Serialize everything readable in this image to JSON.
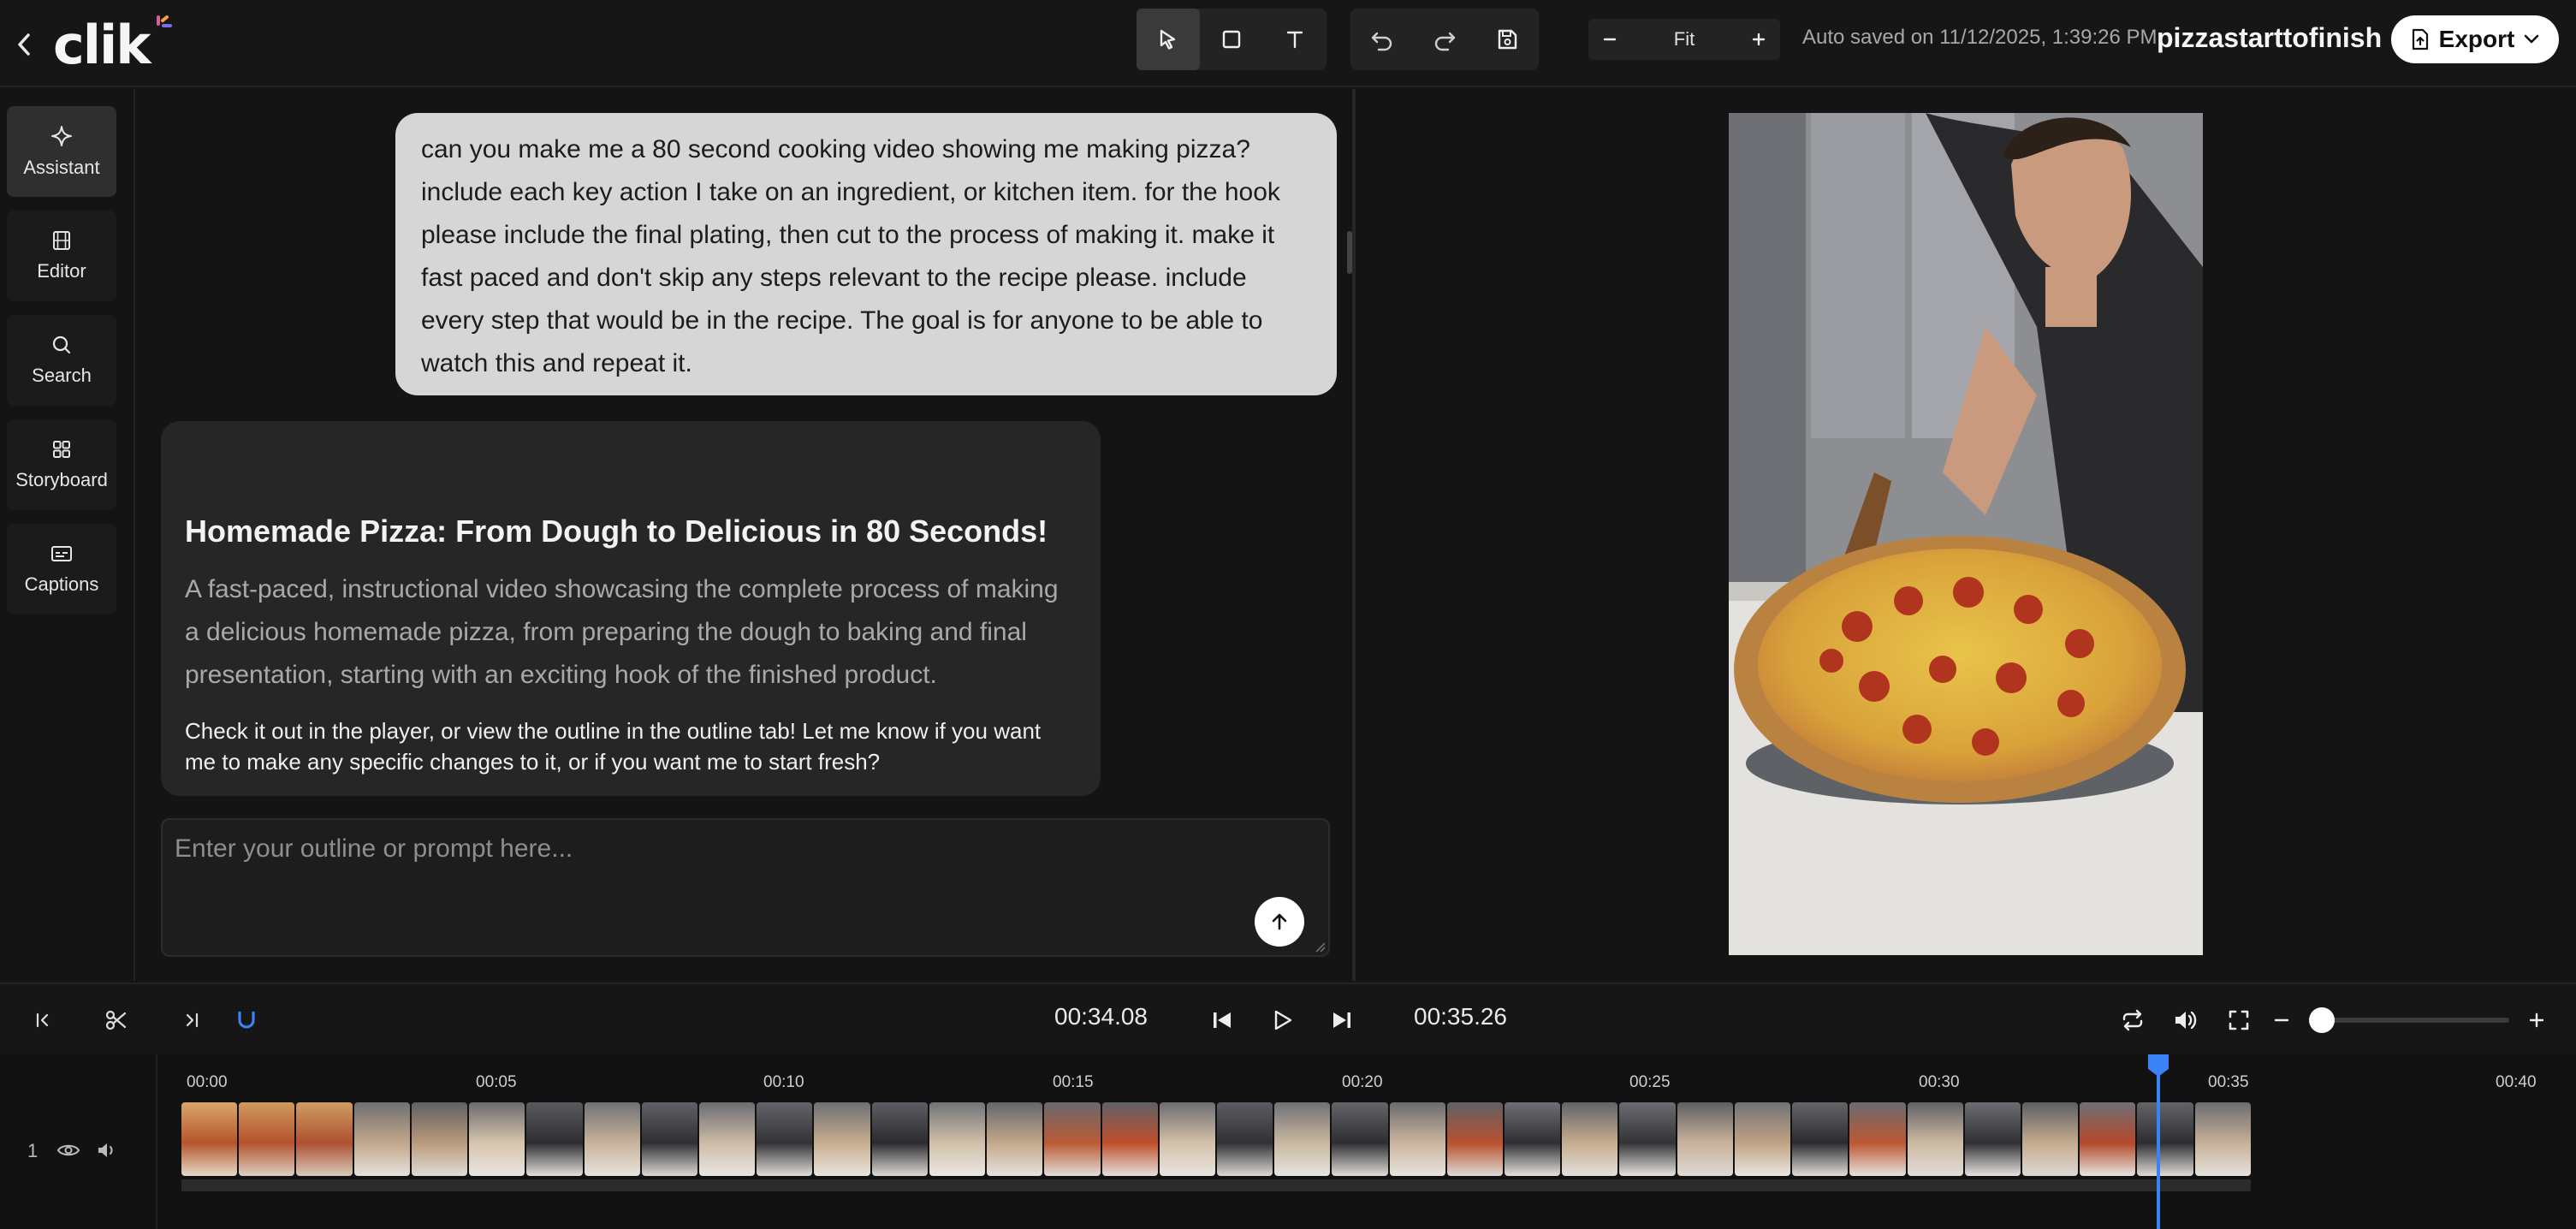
{
  "app": {
    "logo_text": "clik",
    "autosave_text": "Auto saved on 11/12/2025, 1:39:26 PM",
    "project_name": "pizzastarttofinish",
    "export_label": "Export",
    "zoom_label": "Fit"
  },
  "nav": {
    "items": [
      {
        "label": "Assistant",
        "icon": "sparkle-icon",
        "active": true
      },
      {
        "label": "Editor",
        "icon": "film-icon"
      },
      {
        "label": "Search",
        "icon": "search-icon"
      },
      {
        "label": "Storyboard",
        "icon": "grid-icon"
      },
      {
        "label": "Captions",
        "icon": "captions-icon"
      }
    ]
  },
  "chat": {
    "user_message": "can you make me a 80 second cooking video showing me making pizza? include each key action I take on an ingredient, or kitchen item. for the hook please include the final plating, then cut to the process of making it. make it fast paced and don't skip any steps relevant to the recipe please. include every step that would be in the recipe. The goal is for anyone to be able to watch this and repeat it.",
    "assistant_title": "Homemade Pizza: From Dough to Delicious in 80 Seconds!",
    "assistant_description": "A fast-paced, instructional video showcasing the complete process of making a delicious homemade pizza, from preparing the dough to baking and final presentation, starting with an exciting hook of the finished product.",
    "assistant_note": "Check it out in the player, or view the outline in the outline tab! Let me know if you want me to make any specific changes to it, or if you want me to start fresh?",
    "prompt_placeholder": "Enter your outline or prompt here..."
  },
  "playback": {
    "current_time": "00:34.08",
    "total_time": "00:35.26",
    "volume": 0.0
  },
  "timeline": {
    "ruler": [
      "00:00",
      "00:05",
      "00:10",
      "00:15",
      "00:20",
      "00:25",
      "00:30",
      "00:35",
      "00:40"
    ],
    "track_number": "1",
    "playhead_time": "00:34.08"
  },
  "colors": {
    "accent": "#3b82f6",
    "user_bubble": "#d6d6d6",
    "card_bg": "#262626",
    "logo_dot": "#e05a9a"
  }
}
